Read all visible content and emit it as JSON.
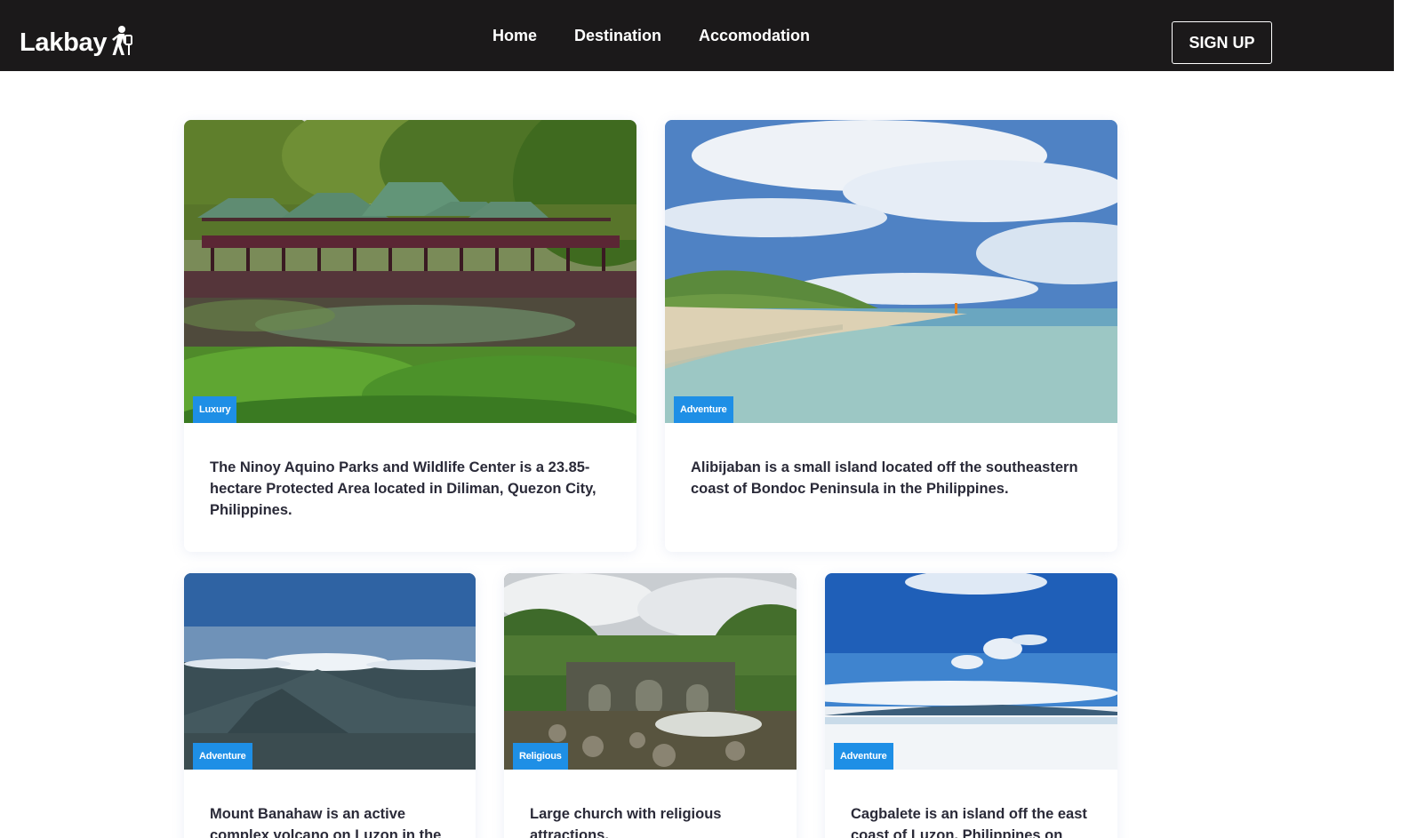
{
  "brand": {
    "name": "Lakbay",
    "icon": "hiker-icon"
  },
  "nav": {
    "links": [
      "Home",
      "Destination",
      "Accomodation"
    ],
    "signup_label": "SIGN UP"
  },
  "colors": {
    "navbar": "#1b191a",
    "badge": "#1e8fe6",
    "text": "#2a2a38"
  },
  "cards": [
    {
      "tag": "Luxury",
      "image": "lake-pavilion-photo",
      "description": "The Ninoy Aquino Parks and Wildlife Center is a 23.85-hectare Protected Area located in Diliman, Quezon City, Philippines."
    },
    {
      "tag": "Adventure",
      "image": "beach-island-photo",
      "description": "Alibijaban is a small island located off the southeastern coast of Bondoc Peninsula in the Philippines."
    },
    {
      "tag": "Adventure",
      "image": "volcano-aerial-photo",
      "description": "Mount Banahaw is an active complex volcano on Luzon in the Philippines."
    },
    {
      "tag": "Religious",
      "image": "stone-bridge-ruins-photo",
      "description": "Large church with religious attractions."
    },
    {
      "tag": "Adventure",
      "image": "sandbar-sky-photo",
      "description": "Cagbalete is an island off the east coast of Luzon, Philippines on Lamon Bay."
    }
  ]
}
